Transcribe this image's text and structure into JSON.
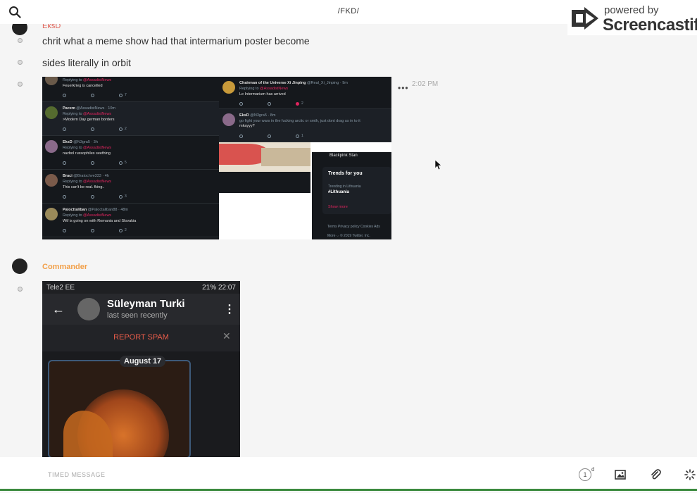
{
  "header": {
    "title": "/FKD/"
  },
  "watermark": {
    "small": "powered by",
    "big": "Screencastify"
  },
  "messages": [
    {
      "user": "EksD",
      "user_color": "#e0655a",
      "items": [
        "chrit what a meme show had that intermarium poster become",
        "sides literally in orbit"
      ],
      "time": "2:02 PM"
    },
    {
      "user": "Commander",
      "user_color": "#f2a04a"
    }
  ],
  "tweets": [
    {
      "name": "",
      "reply_to": "@AssadistNews",
      "body": "Feuerkrieg is cancelled",
      "likes": "7"
    },
    {
      "name": "Pacem",
      "handle": "@AssadistNews · 10m",
      "reply_to": "@AssadistNews",
      "body": ">Modern Day german borders",
      "likes": "2"
    },
    {
      "name": "EksD",
      "handle": "@N3gra5 · 3h",
      "reply_to": "@AssadistNews",
      "body": "nazbol russophiles seething",
      "likes": "5"
    },
    {
      "name": "Braci",
      "handle": "@Bratochve333 · 4h",
      "reply_to": "@AssadistNews",
      "body": "This can't be real. fking..",
      "likes": "3"
    },
    {
      "name": "Palocttaliban",
      "handle": "@Paloctaliban88 · 48m",
      "reply_to": "@AssadistNews",
      "body": "Wtf is going on with Romania and Slovakia",
      "likes": "2"
    }
  ],
  "tweets_right": [
    {
      "name": "Chairman of the Universe Xi Jinping",
      "handle": "@Real_Xi_Jinping · 9m",
      "reply_to": "@AssadistNews",
      "body": "Le Intermarium has arrived",
      "likes": "2"
    },
    {
      "name": "EksD",
      "handle": "@N3gra5 · 8m",
      "reply_to": "",
      "body": "go fight your wars in the fucking arctic or smth, just dont drag us in to it",
      "body2": "mkayyy?",
      "likes": "1"
    }
  ],
  "sidebar_tw": {
    "stan": "Blackpink Stan",
    "trends_title": "Trends for you",
    "trending_sub": "Trending in Lithuania",
    "trend": "#Lithuania",
    "show_more": "Show more",
    "footer": "Terms   Privacy policy   Cookies   Ads",
    "footer2": "More ⌵   © 2019 Twitter, Inc."
  },
  "phone": {
    "carrier": "Tele2 EE",
    "status_right": "21% 22:07",
    "contact": "Süleyman Turki",
    "seen": "last seen recently",
    "spam": "REPORT SPAM",
    "date": "August 17"
  },
  "bottombar": {
    "timed_label": "TIMED MESSAGE",
    "timer_value": "1",
    "timer_unit": "d"
  }
}
